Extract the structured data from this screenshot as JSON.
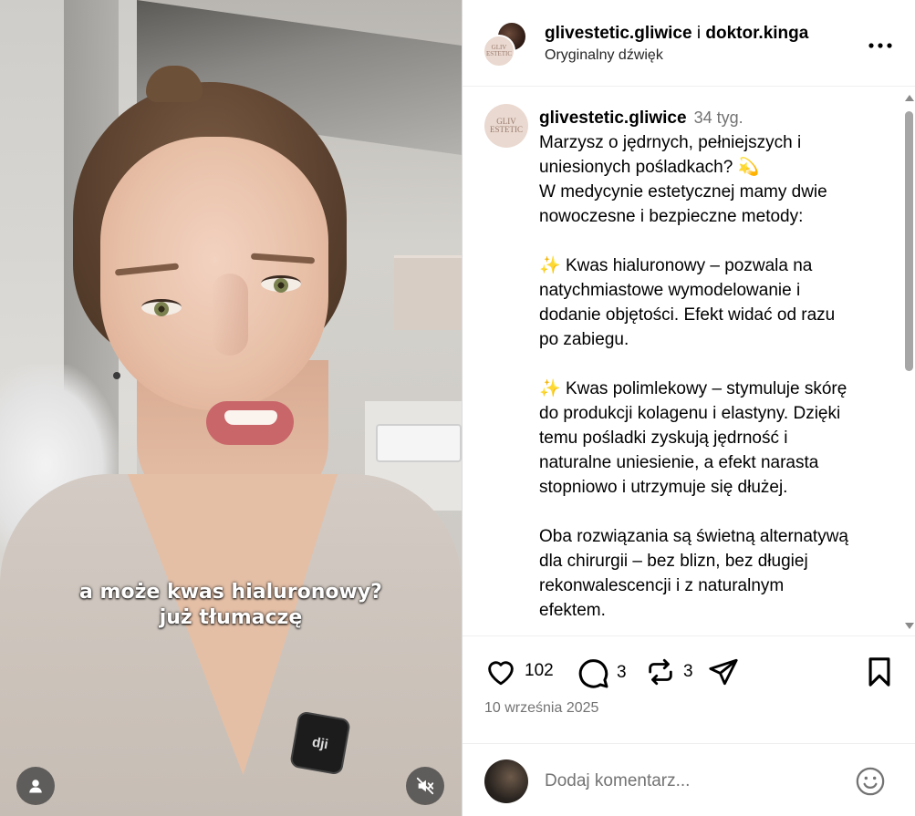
{
  "video": {
    "caption_line1": "a może kwas hialuronowy?",
    "caption_line2": "już tłumaczę",
    "mic_label": "dji"
  },
  "header": {
    "user1": "glivestetic.gliwice",
    "joiner": "i",
    "user2": "doktor.kinga",
    "audio": "Oryginalny dźwięk",
    "avatar_text_1": "GLIV",
    "avatar_text_2": "ESTETIC"
  },
  "comment": {
    "username": "glivestetic.gliwice",
    "time": "34 tyg.",
    "avatar_text_1": "GLIV",
    "avatar_text_2": "ESTETIC",
    "lines": [
      "Marzysz o jędrnych, pełniejszych i",
      "uniesionych pośladkach?",
      "W medycynie estetycznej mamy dwie",
      "nowoczesne i bezpieczne metody:",
      "",
      "Kwas hialuronowy – pozwala na",
      "natychmiastowe wymodelowanie i",
      "dodanie objętości. Efekt widać od razu",
      "po zabiegu.",
      "",
      "Kwas polimlekowy – stymuluje skórę",
      "do produkcji kolagenu i elastyny. Dzięki",
      "temu pośladki zyskują jędrność i",
      "naturalne uniesienie, a efekt narasta",
      "stopniowo i utrzymuje się dłużej.",
      "",
      "Oba rozwiązania są świetną alternatywą",
      "dla chirurgii – bez blizn, bez długiej",
      "rekonwalescencji i z naturalnym",
      "efektem."
    ]
  },
  "actions": {
    "likes": "102",
    "comments": "3",
    "reposts": "3",
    "date": "10 września 2025"
  },
  "add_comment": {
    "placeholder": "Dodaj komentarz..."
  },
  "colors": {
    "muted_text": "#737373",
    "divider": "#efefef",
    "sparkle": "#f1b94b"
  }
}
